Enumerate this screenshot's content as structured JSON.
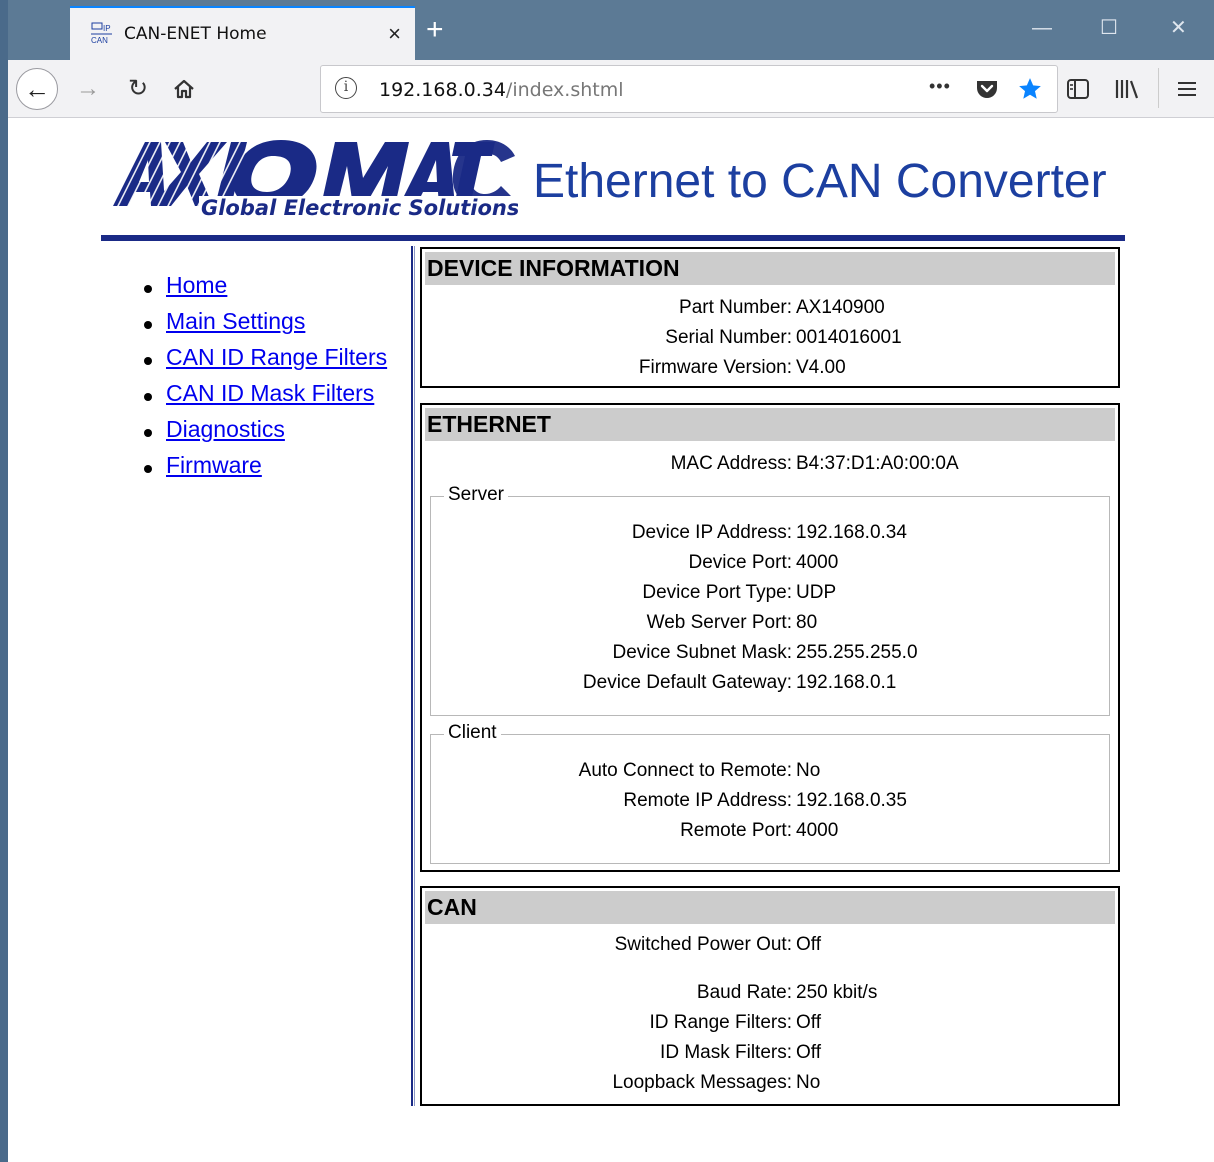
{
  "browser": {
    "tab_title": "CAN-ENET Home",
    "tab_favicon_top": "IP",
    "tab_favicon_bottom": "CAN",
    "tab_close": "×",
    "new_tab": "+",
    "window_minimize": "—",
    "window_maximize": "☐",
    "window_close": "✕",
    "url_host": "192.168.0.34",
    "url_path": "/index.shtml",
    "url_info_icon": "i",
    "page_actions": "•••",
    "accent_color": "#0a84ff",
    "titlebar_color": "#5c7a95",
    "icons": [
      "back-icon",
      "forward-icon",
      "reload-icon",
      "home-icon",
      "info-icon",
      "more-icon",
      "pocket-icon",
      "bookmark-star-icon",
      "sidebar-icon",
      "library-icon",
      "menu-icon"
    ]
  },
  "header": {
    "logo_text": "AXIOMATIC",
    "logo_tagline": "Global Electronic Solutions",
    "title": "Ethernet to CAN Converter",
    "title_color": "#1c3fa0",
    "rule_color": "#1a2a86"
  },
  "nav": {
    "items": [
      {
        "label": "Home"
      },
      {
        "label": "Main Settings"
      },
      {
        "label": "CAN ID Range Filters"
      },
      {
        "label": "CAN ID Mask Filters"
      },
      {
        "label": "Diagnostics"
      },
      {
        "label": "Firmware"
      }
    ]
  },
  "device_info": {
    "title": "DEVICE INFORMATION",
    "rows": [
      {
        "label": "Part Number:",
        "value": "AX140900"
      },
      {
        "label": "Serial Number:",
        "value": "0014016001"
      },
      {
        "label": "Firmware Version:",
        "value": "V4.00"
      }
    ]
  },
  "ethernet": {
    "title": "ETHERNET",
    "mac": {
      "label": "MAC Address:",
      "value": "B4:37:D1:A0:00:0A"
    },
    "server": {
      "legend": "Server",
      "rows": [
        {
          "label": "Device IP Address:",
          "value": "192.168.0.34"
        },
        {
          "label": "Device Port:",
          "value": "4000"
        },
        {
          "label": "Device Port Type:",
          "value": "UDP"
        },
        {
          "label": "Web Server Port:",
          "value": "80"
        },
        {
          "label": "Device Subnet Mask:",
          "value": "255.255.255.0"
        },
        {
          "label": "Device Default Gateway:",
          "value": "192.168.0.1"
        }
      ]
    },
    "client": {
      "legend": "Client",
      "rows": [
        {
          "label": "Auto Connect to Remote:",
          "value": "No"
        },
        {
          "label": "Remote IP Address:",
          "value": "192.168.0.35"
        },
        {
          "label": "Remote Port:",
          "value": "4000"
        }
      ]
    }
  },
  "can": {
    "title": "CAN",
    "rows": [
      {
        "label": "Switched Power Out:",
        "value": "Off"
      },
      {
        "label": "Baud Rate:",
        "value": "250 kbit/s"
      },
      {
        "label": "ID Range Filters:",
        "value": "Off"
      },
      {
        "label": "ID Mask Filters:",
        "value": "Off"
      },
      {
        "label": "Loopback Messages:",
        "value": "No"
      }
    ]
  }
}
